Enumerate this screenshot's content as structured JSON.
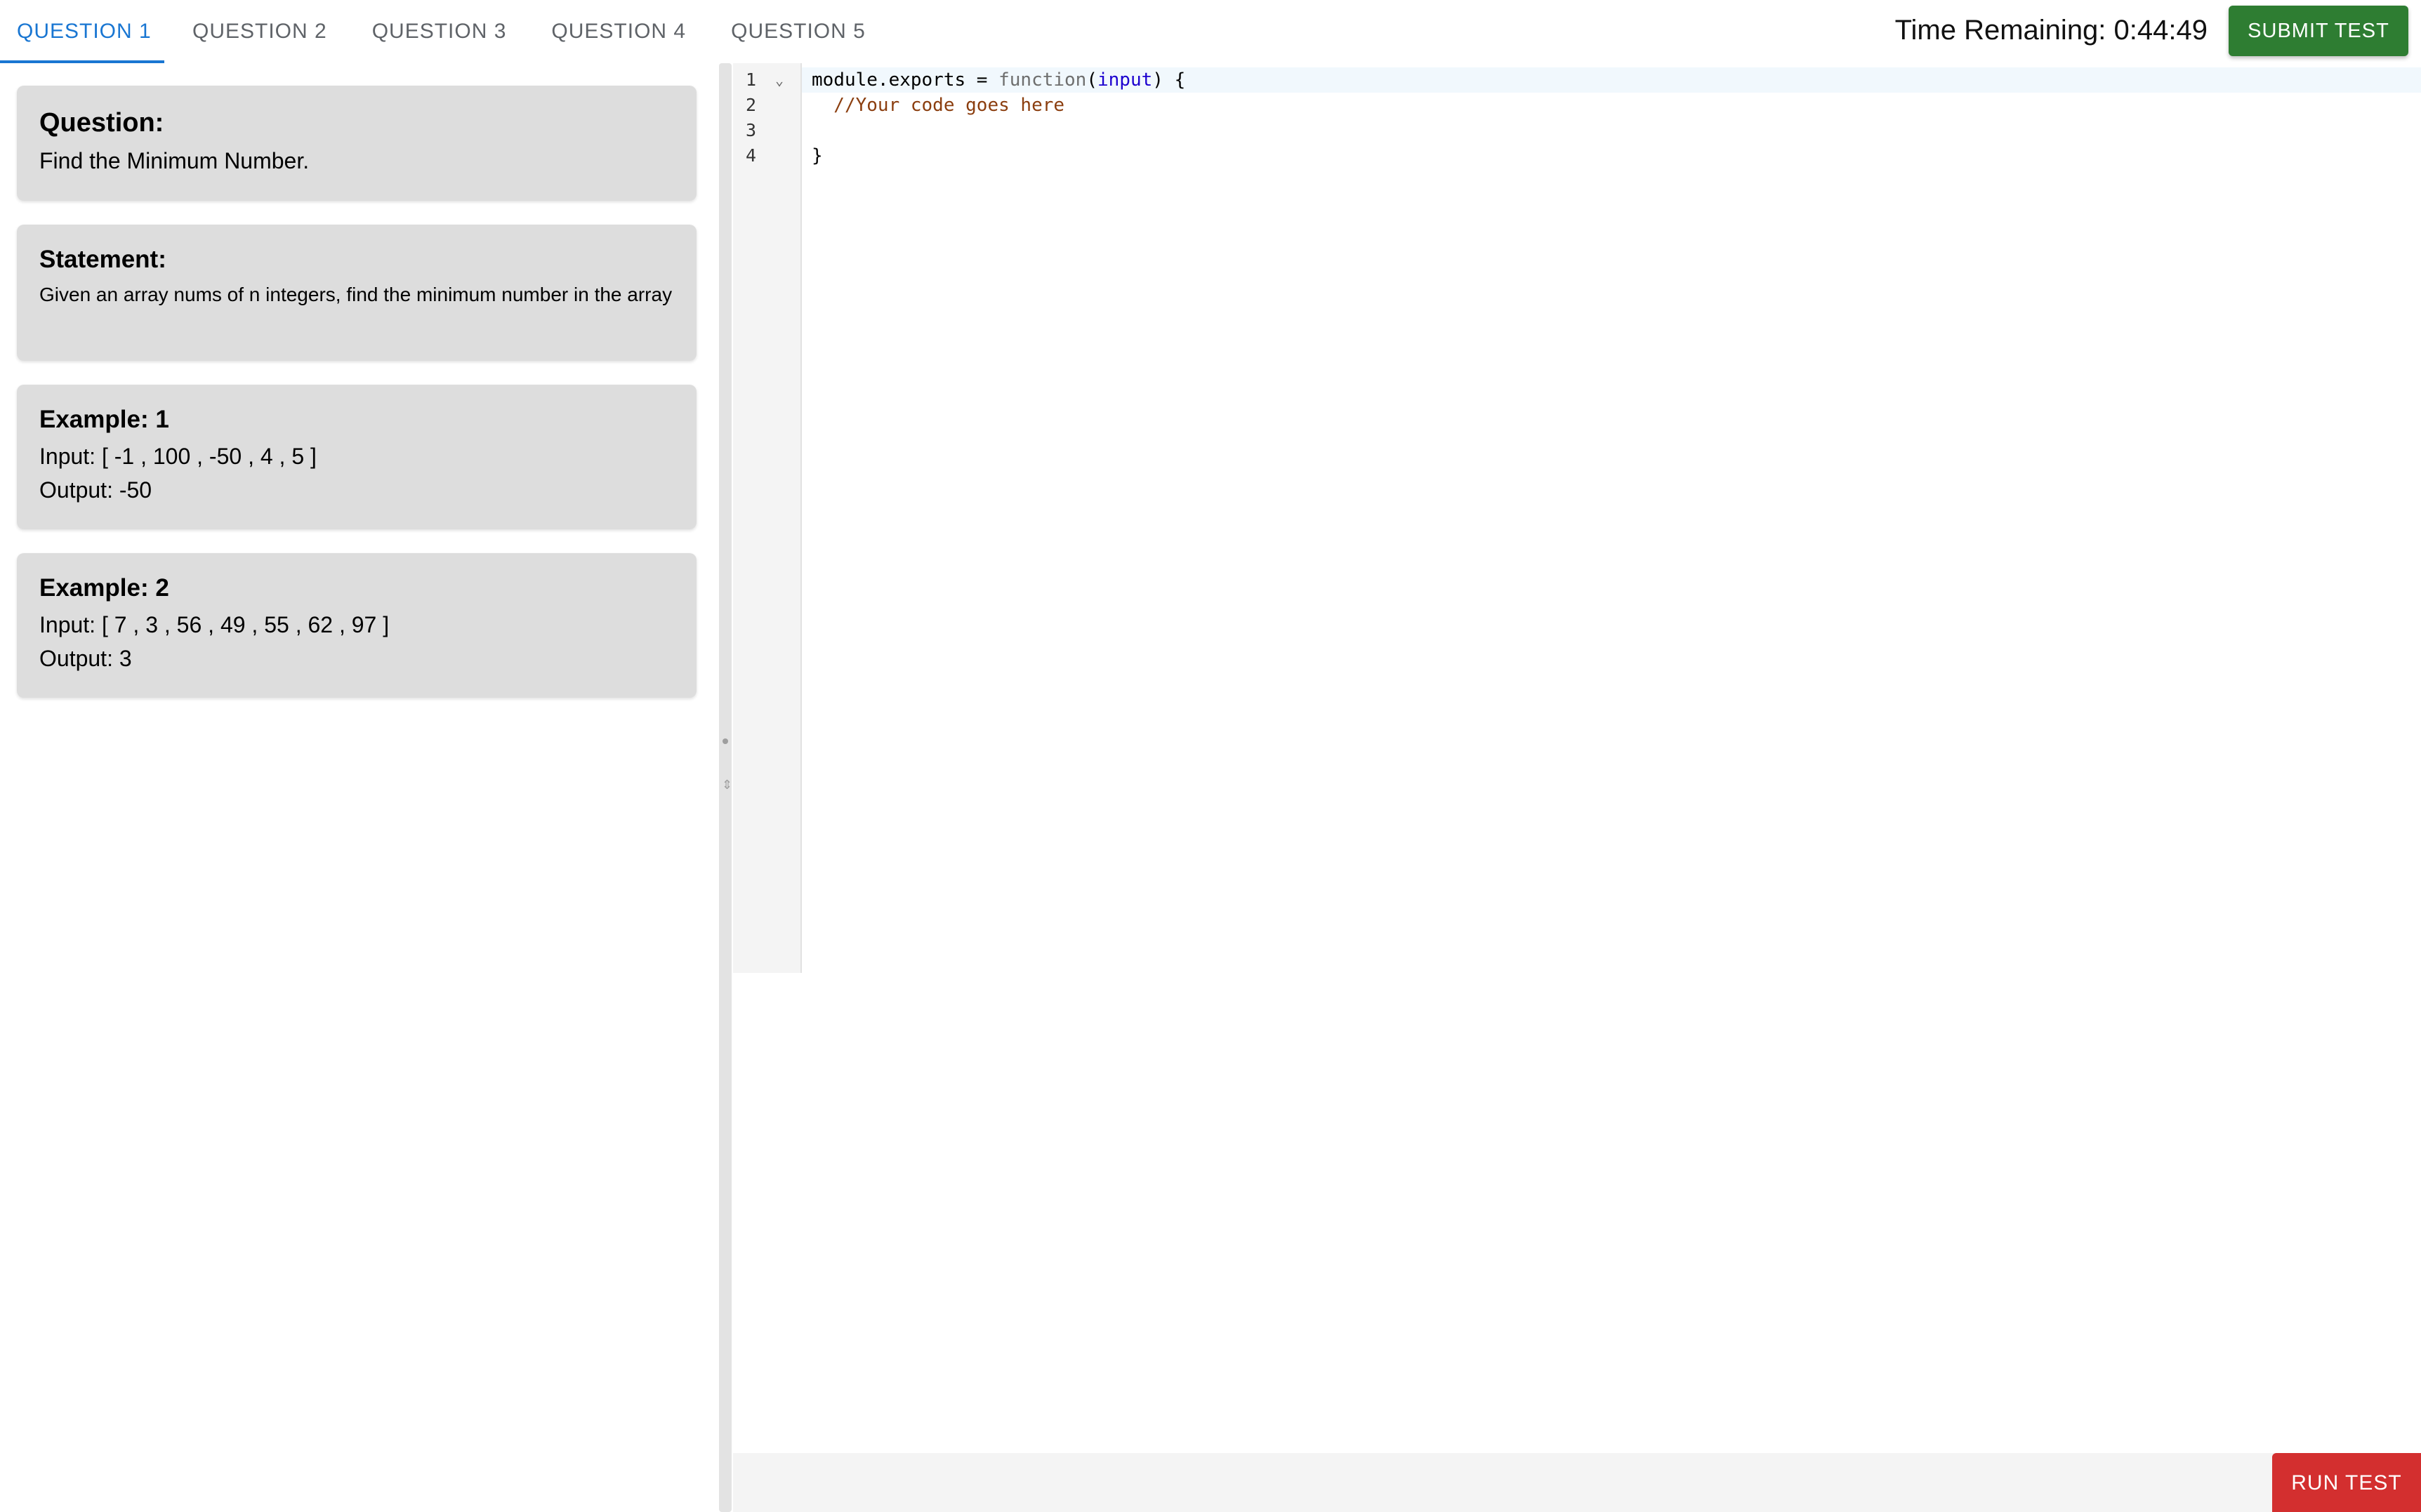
{
  "tabs": [
    {
      "label": "QUESTION 1",
      "active": true
    },
    {
      "label": "QUESTION 2",
      "active": false
    },
    {
      "label": "QUESTION 3",
      "active": false
    },
    {
      "label": "QUESTION 4",
      "active": false
    },
    {
      "label": "QUESTION 5",
      "active": false
    }
  ],
  "header": {
    "timer_label": "Time Remaining: 0:44:49",
    "submit_label": "SUBMIT TEST"
  },
  "question": {
    "title": "Question:",
    "text": "Find the Minimum Number."
  },
  "statement": {
    "title": "Statement:",
    "text": "Given an array nums of n integers, find the minimum number in the array"
  },
  "examples": [
    {
      "title": "Example: 1",
      "input": "Input: [ -1 , 100 , -50 , 4 , 5 ]",
      "output": "Output: -50"
    },
    {
      "title": "Example: 2",
      "input": "Input: [ 7 , 3 , 56 , 49 , 55 , 62 , 97 ]",
      "output": "Output: 3"
    }
  ],
  "editor": {
    "line_numbers": [
      "1",
      "2",
      "3",
      "4"
    ],
    "code": {
      "l1_a": "module.exports = ",
      "l1_fn": "function",
      "l1_b": "(",
      "l1_param": "input",
      "l1_c": ") {",
      "l2_comment": "  //Your code goes here",
      "l3": "",
      "l4": "}"
    }
  },
  "footer": {
    "run_label": "RUN TEST"
  },
  "colors": {
    "accent_blue": "#1976d2",
    "submit_green": "#2e7d32",
    "run_red": "#d32f2f",
    "card_bg": "#dddddd"
  }
}
